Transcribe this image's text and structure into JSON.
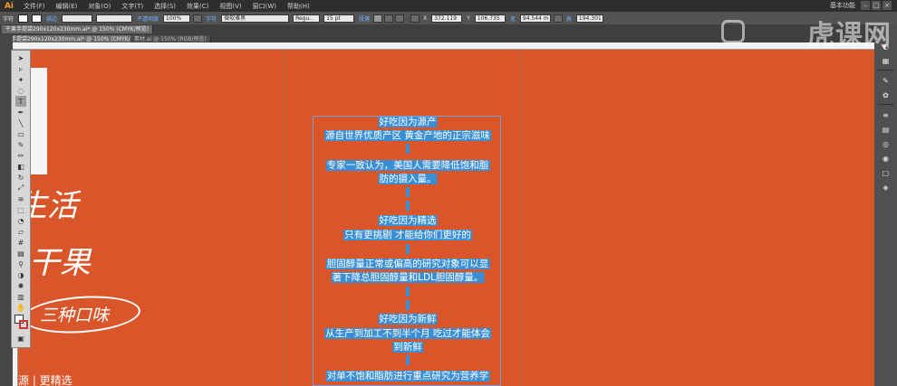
{
  "app": {
    "logo": "Ai",
    "workspace": "基本功能",
    "menu": [
      "文件(F)",
      "编辑(E)",
      "对象(O)",
      "文字(T)",
      "选择(S)",
      "效果(C)",
      "视图(V)",
      "窗口(W)",
      "帮助(H)"
    ],
    "window_controls": [
      "–",
      "□",
      "×"
    ]
  },
  "control_bar": {
    "type_label": "字符",
    "stroke_label": "描边",
    "opacity_label": "不透明度",
    "opacity_value": "100%",
    "char_link": "字符",
    "font_family": "微软雅黑",
    "font_style": "Regu..",
    "font_size": "15 pt",
    "para_link": "段落",
    "x_value": "372.119",
    "y_value": "106.735",
    "w_label": "宽",
    "w_value": "94.544 m",
    "h_label": "高",
    "h_value": "194.301"
  },
  "watermark": {
    "text": "虎课网"
  },
  "tabs": [
    "干果手提袋290x120x230mm.ai* @ 150% (CMYK/预览)",
    "果手提袋290x120x230mm.ai* @ 150% (CMYK/预览)",
    "素材.ai @ 150% (RGB/预览)"
  ],
  "canvas": {
    "text_block": [
      "好吃因为源产",
      "源自世界优质产区 黄金产地的正宗滋味",
      "专家一致认为，美国人需要降低饱和脂",
      "肪的摄入量。",
      "好吃因为精选",
      "只有更挑剔 才能给你们更好的",
      "胆固醇量正常或偏高的研究对象可以显",
      "著下降总胆固醇量和LDL胆固醇量。",
      "好吃因为新鲜",
      "从生产到加工不到半个月 吃过才能体会",
      "到新鲜",
      "对单不饱和脂肪进行重点研究为营养学"
    ],
    "artwork": {
      "line1": "生活",
      "line2": "干果",
      "badge": "三种口味",
      "bottom": "源 | 更精选"
    }
  },
  "colors": {
    "canvas_bg": "#d9562b",
    "text_highlight": "#3a8fd4",
    "text_frame": "#7a9bd8"
  }
}
